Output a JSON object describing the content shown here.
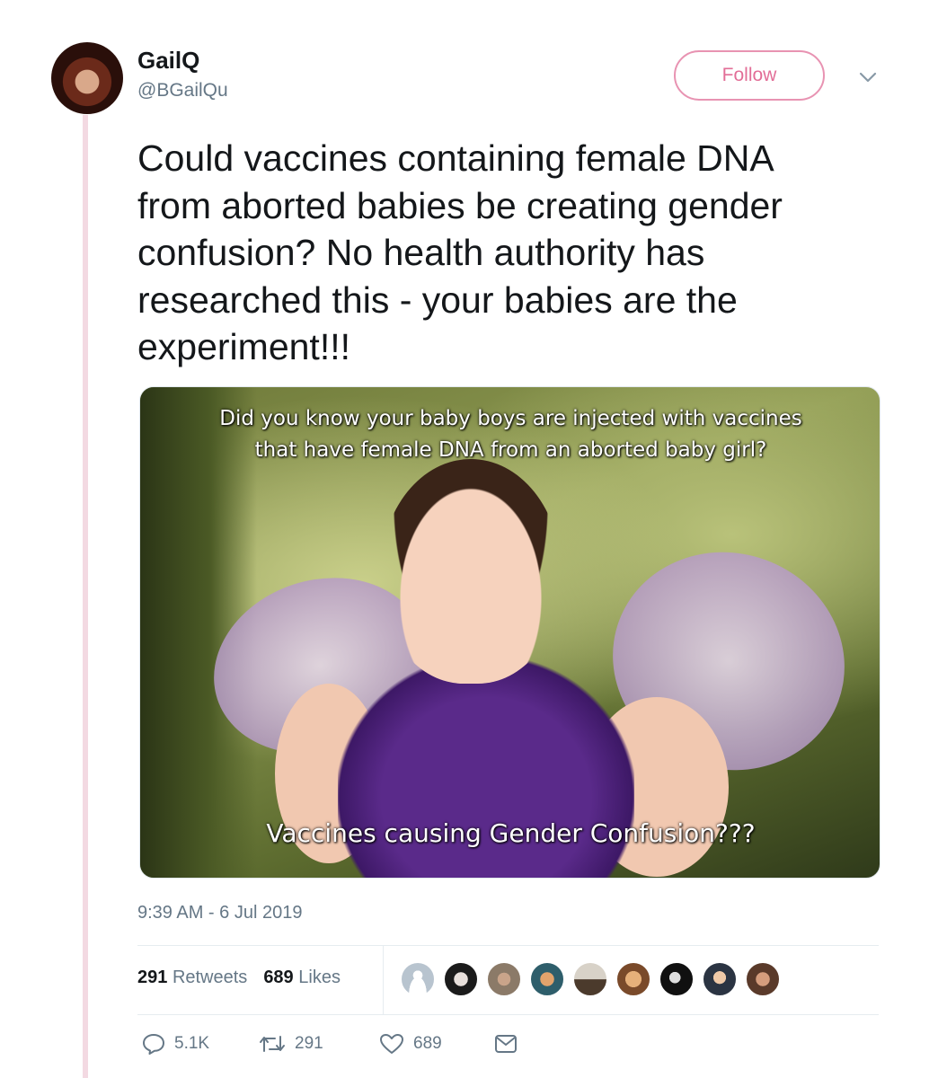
{
  "author": {
    "display_name": "GailQ",
    "handle": "@BGailQu",
    "follow_label": "Follow"
  },
  "tweet": {
    "text": "Could vaccines containing female DNA\nfrom aborted babies be creating gender\nconfusion?   No health authority has\nresearched this - your babies are the\nexperiment!!!",
    "timestamp": "9:39 AM - 6 Jul 2019"
  },
  "media": {
    "caption_top": "Did you know your baby boys are injected with vaccines\nthat have female DNA from an aborted baby girl?",
    "caption_bottom": "Vaccines causing Gender Confusion???"
  },
  "stats": {
    "retweets_count": "291",
    "retweets_label": "Retweets",
    "likes_count": "689",
    "likes_label": "Likes"
  },
  "actions": {
    "reply_count": "5.1K",
    "retweet_count": "291",
    "like_count": "689"
  },
  "colors": {
    "accent": "#e26e97",
    "thread_line": "#f3d9e2",
    "muted": "#657786"
  },
  "likers": [
    "default-avatar",
    "avatar-1",
    "avatar-2",
    "avatar-3",
    "avatar-4",
    "avatar-5",
    "avatar-6",
    "avatar-7",
    "avatar-8"
  ]
}
